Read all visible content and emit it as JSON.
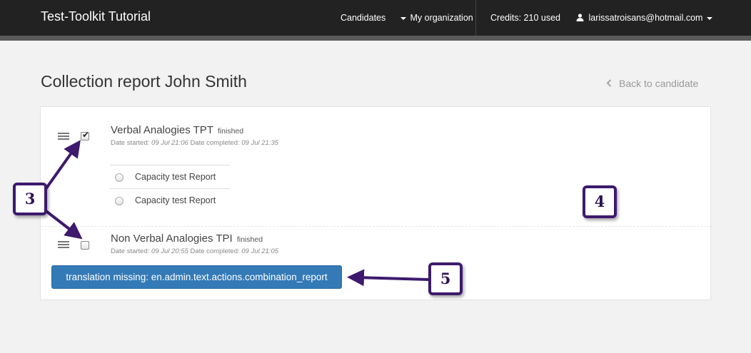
{
  "navbar": {
    "brand": "Test-Toolkit Tutorial",
    "candidates": "Candidates",
    "organization": "My organization",
    "credits": "Credits: 210 used",
    "user_email": "larissatroisans@hotmail.com"
  },
  "header": {
    "title": "Collection report John Smith",
    "back_label": "Back to candidate"
  },
  "tests": [
    {
      "title": "Verbal Analogies TPT",
      "status": "finished",
      "date_started_label": "Date started:",
      "date_started": "09 Jul 21:06",
      "date_completed_label": "Date completed:",
      "date_completed": "09 Jul 21:35",
      "checked": true,
      "reports": [
        "Capacity test Report",
        "Capacity test Report"
      ]
    },
    {
      "title": "Non Verbal Analogies TPI",
      "status": "finished",
      "date_started_label": "Date started:",
      "date_started": "09 Jul 20:55",
      "date_completed_label": "Date completed:",
      "date_completed": "09 Jul 21:05",
      "checked": false,
      "reports": []
    }
  ],
  "actions": {
    "combination_report": "translation missing: en.admin.text.actions.combination_report"
  },
  "annotations": {
    "callout_3": "3",
    "callout_4": "4",
    "callout_5": "5",
    "color": "#3d1a6e"
  }
}
